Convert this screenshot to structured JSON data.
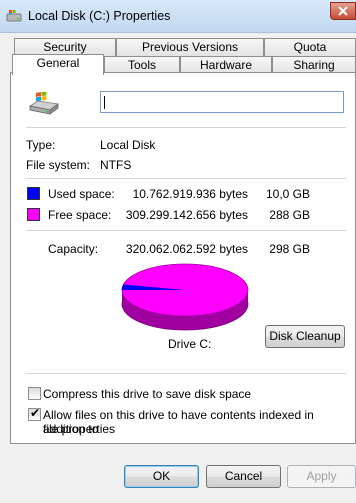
{
  "window": {
    "title": "Local Disk (C:) Properties"
  },
  "tabs_back": [
    "Security",
    "Previous Versions",
    "Quota"
  ],
  "tabs_front": [
    "General",
    "Tools",
    "Hardware",
    "Sharing"
  ],
  "general": {
    "name_value": "",
    "type_label": "Type:",
    "type_value": "Local Disk",
    "fs_label": "File system:",
    "fs_value": "NTFS",
    "used": {
      "label": "Used space:",
      "bytes": "10.762.919.936 bytes",
      "size": "10,0 GB",
      "color": "#0000ff",
      "fraction": 0.0336
    },
    "free": {
      "label": "Free space:",
      "bytes": "309.299.142.656 bytes",
      "size": "288 GB",
      "color": "#ff00ff"
    },
    "capacity": {
      "label": "Capacity:",
      "bytes": "320.062.062.592 bytes",
      "size": "298 GB"
    },
    "drive_label": "Drive C:",
    "cleanup_button": "Disk Cleanup",
    "compress": {
      "label": "Compress this drive to save disk space",
      "checked": false
    },
    "index": {
      "label_line1": "Allow files on this drive to have contents indexed in addition to",
      "label_line2": "file properties",
      "checked": true
    }
  },
  "buttons": {
    "ok": "OK",
    "cancel": "Cancel",
    "apply": "Apply"
  },
  "icons": {
    "title": "drive-icon",
    "drive": "windows-drive-icon"
  }
}
